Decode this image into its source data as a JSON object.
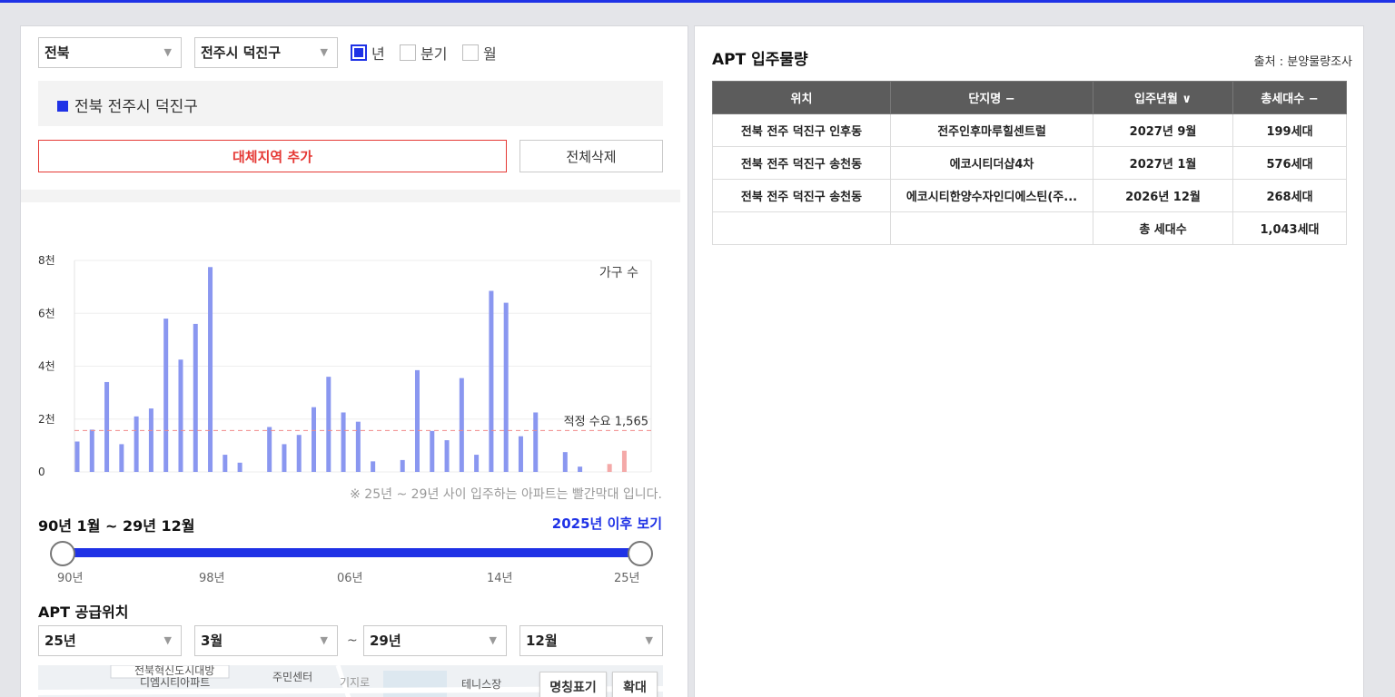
{
  "filters": {
    "province": "전북",
    "city": "전주시 덕진구",
    "period_options": [
      {
        "label": "년",
        "checked": true
      },
      {
        "label": "분기",
        "checked": false
      },
      {
        "label": "월",
        "checked": false
      }
    ]
  },
  "selected_region": "전북 전주시 덕진구",
  "buttons": {
    "add_region": "대체지역 추가",
    "delete_all": "전체삭제"
  },
  "chart_data": {
    "type": "bar",
    "legend_label": "가구 수",
    "y_ticks": [
      "0",
      "2천",
      "4천",
      "6천",
      "8천"
    ],
    "ylim": [
      0,
      8000
    ],
    "x_ticks": [
      "1990",
      "1993",
      "1996",
      "1999",
      "2002",
      "2005",
      "2008",
      "2011",
      "2014",
      "2017",
      "2020",
      "2023",
      "2026",
      "2029"
    ],
    "x": [
      1990,
      1991,
      1992,
      1993,
      1994,
      1995,
      1996,
      1997,
      1998,
      1999,
      2000,
      2001,
      2002,
      2003,
      2004,
      2005,
      2006,
      2007,
      2008,
      2009,
      2010,
      2011,
      2012,
      2013,
      2014,
      2015,
      2016,
      2017,
      2018,
      2019,
      2020,
      2021,
      2022,
      2023,
      2024,
      2025,
      2026,
      2027,
      2028,
      2029
    ],
    "values": [
      1150,
      1600,
      3400,
      1050,
      2100,
      2400,
      5800,
      4250,
      5600,
      7750,
      650,
      350,
      0,
      1700,
      1050,
      1400,
      2450,
      3600,
      2250,
      1900,
      400,
      0,
      450,
      3850,
      1550,
      1200,
      3550,
      650,
      6850,
      6400,
      1350,
      2250,
      0,
      750,
      200,
      0,
      300,
      800,
      0,
      0
    ],
    "highlight_from": 2025,
    "series_color": "#8a97f0",
    "highlight_color": "#f4a9a8",
    "reference": {
      "label": "적정 수요 1,565",
      "value": 1565,
      "color": "#f08a8a"
    }
  },
  "chart_note": "※ 25년 ~ 29년 사이 입주하는 아파트는 빨간막대 입니다.",
  "period_range": "90년 1월 ~ 29년 12월",
  "after_link": "2025년 이후 보기",
  "slider": {
    "ticks": [
      "90년",
      "98년",
      "06년",
      "14년",
      "25년"
    ],
    "min_label": "90년",
    "max_label": "25년"
  },
  "supply": {
    "title": "APT 공급위치",
    "from_year": "25년",
    "from_month": "3월",
    "tilde": "~",
    "to_year": "29년",
    "to_month": "12월"
  },
  "map": {
    "labels": [
      "전북혁신도시대방",
      "디엠시티아파트",
      "주민센터",
      "기지로",
      "테니스장"
    ],
    "buttons": [
      "명칭표기",
      "확대"
    ]
  },
  "table": {
    "title": "APT 입주물량",
    "source": "출처 : 분양물량조사",
    "headers": [
      "위치",
      "단지명 −",
      "입주년월 ∨",
      "총세대수 −"
    ],
    "rows": [
      [
        "전북 전주 덕진구 인후동",
        "전주인후마루힐센트럴",
        "2027년 9월",
        "199세대"
      ],
      [
        "전북 전주 덕진구 송천동",
        "에코시티더샵4차",
        "2027년 1월",
        "576세대"
      ],
      [
        "전북 전주 덕진구 송천동",
        "에코시티한양수자인디에스틴(주...",
        "2026년 12월",
        "268세대"
      ]
    ],
    "total_label": "총 세대수",
    "total_value": "1,043세대"
  }
}
